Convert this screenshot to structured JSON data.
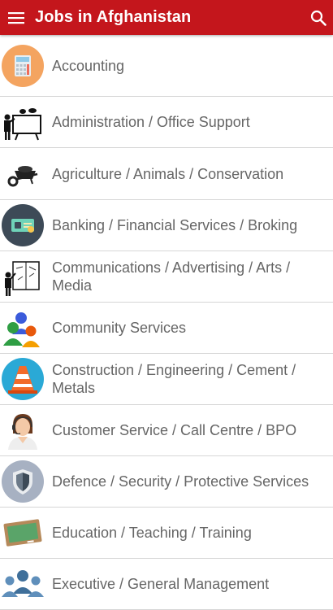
{
  "appbar": {
    "title": "Jobs in Afghanistan",
    "menu_icon": "hamburger-menu-icon",
    "search_icon": "search-icon",
    "color": "#c4161c"
  },
  "categories": [
    {
      "label": "Accounting",
      "icon": "calculator-icon"
    },
    {
      "label": "Administration / Office Support",
      "icon": "presentation-board-icon"
    },
    {
      "label": "Agriculture / Animals / Conservation",
      "icon": "wheelbarrow-icon"
    },
    {
      "label": "Banking / Financial Services / Broking",
      "icon": "bank-card-icon"
    },
    {
      "label": "Communications / Advertising / Arts / Media",
      "icon": "whiteboard-presenter-icon"
    },
    {
      "label": "Community Services",
      "icon": "people-group-icon"
    },
    {
      "label": "Construction / Engineering / Cement / Metals",
      "icon": "traffic-cone-icon"
    },
    {
      "label": "Customer Service / Call Centre / BPO",
      "icon": "headset-agent-icon"
    },
    {
      "label": "Defence / Security / Protective Services",
      "icon": "shield-icon"
    },
    {
      "label": "Education / Teaching / Training",
      "icon": "chalkboard-icon"
    },
    {
      "label": "Executive / General Management",
      "icon": "team-icon"
    }
  ]
}
